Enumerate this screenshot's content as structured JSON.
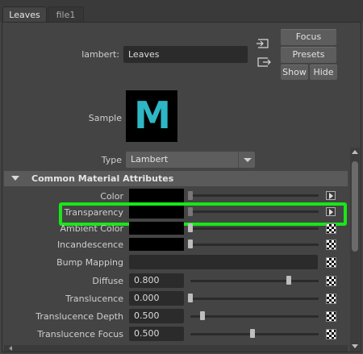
{
  "tabs": [
    {
      "label": "Leaves"
    },
    {
      "label": "file1"
    }
  ],
  "header": {
    "material_label": "lambert:",
    "material_value": "Leaves",
    "focus_label": "Focus",
    "presets_label": "Presets",
    "show_label": "Show",
    "hide_label": "Hide",
    "sample_label": "Sample",
    "sample_glyph": "M",
    "type_label": "Type",
    "type_value": "Lambert"
  },
  "section": {
    "title": "Common Material Attributes",
    "expanded": true
  },
  "attributes": [
    {
      "label": "Color"
    },
    {
      "label": "Transparency",
      "highlighted": true
    },
    {
      "label": "Ambient Color"
    },
    {
      "label": "Incandescence"
    },
    {
      "label": "Bump Mapping"
    },
    {
      "label": "Diffuse",
      "value": "0.800",
      "slider": 0.8
    },
    {
      "label": "Translucence",
      "value": "0.000",
      "slider": 0.0
    },
    {
      "label": "Translucence Depth",
      "value": "0.500",
      "slider": 0.1
    },
    {
      "label": "Translucence Focus",
      "value": "0.500",
      "slider": 0.5
    }
  ],
  "colors": {
    "highlight": "#19e619",
    "logo": "#2fb6c4"
  }
}
